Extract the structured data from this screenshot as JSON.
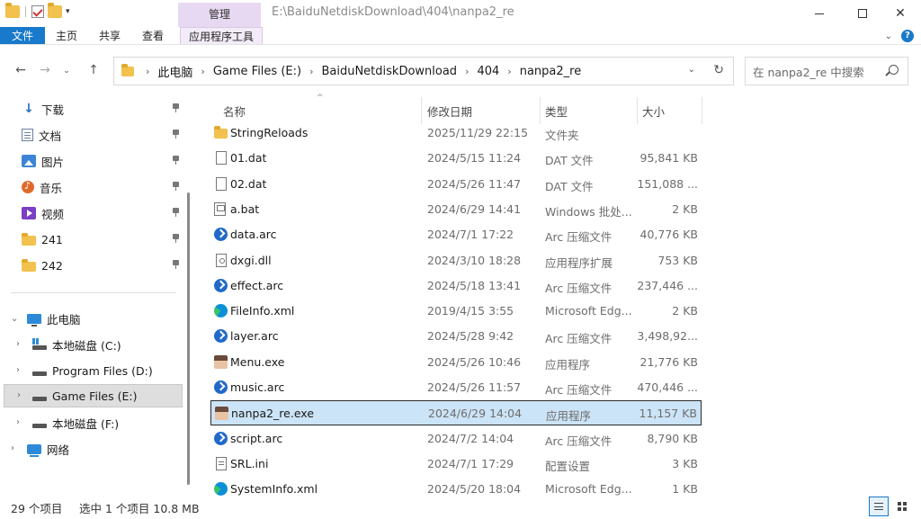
{
  "window": {
    "path_title": "E:\\BaiduNetdiskDownload\\404\\nanpa2_re",
    "context_group": "管理"
  },
  "ribbon": {
    "tabs": [
      "文件",
      "主页",
      "共享",
      "查看"
    ],
    "context_tab": "应用程序工具"
  },
  "address": {
    "crumbs": [
      "此电脑",
      "Game Files (E:)",
      "BaiduNetdiskDownload",
      "404",
      "nanpa2_re"
    ],
    "search_placeholder": "在 nanpa2_re 中搜索"
  },
  "nav": {
    "quick_access": [
      {
        "label": "下载",
        "icon": "download-icon"
      },
      {
        "label": "文档",
        "icon": "documents-icon"
      },
      {
        "label": "图片",
        "icon": "pictures-icon"
      },
      {
        "label": "音乐",
        "icon": "music-icon"
      },
      {
        "label": "视频",
        "icon": "videos-icon"
      },
      {
        "label": "241",
        "icon": "folder-icon"
      },
      {
        "label": "242",
        "icon": "folder-icon"
      }
    ],
    "this_pc": "此电脑",
    "drives": [
      "本地磁盘 (C:)",
      "Program Files (D:)",
      "Game Files (E:)",
      "本地磁盘 (F:)"
    ],
    "network": "网络"
  },
  "columns": {
    "name": "名称",
    "date": "修改日期",
    "type": "类型",
    "size": "大小"
  },
  "files": [
    {
      "name": "StringReloads",
      "date": "2025/11/29 22:15",
      "type": "文件夹",
      "size": "",
      "icon": "folder-icon"
    },
    {
      "name": "01.dat",
      "date": "2024/5/15 11:24",
      "type": "DAT 文件",
      "size": "95,841 KB",
      "icon": "file-icon"
    },
    {
      "name": "02.dat",
      "date": "2024/5/26 11:47",
      "type": "DAT 文件",
      "size": "151,088 ...",
      "icon": "file-icon"
    },
    {
      "name": "a.bat",
      "date": "2024/6/29 14:41",
      "type": "Windows 批处...",
      "size": "2 KB",
      "icon": "batch-file-icon"
    },
    {
      "name": "data.arc",
      "date": "2024/7/1 17:22",
      "type": "Arc 压缩文件",
      "size": "40,776 KB",
      "icon": "arc-archive-icon"
    },
    {
      "name": "dxgi.dll",
      "date": "2024/3/10 18:28",
      "type": "应用程序扩展",
      "size": "753 KB",
      "icon": "dll-file-icon"
    },
    {
      "name": "effect.arc",
      "date": "2024/5/18 13:41",
      "type": "Arc 压缩文件",
      "size": "237,446 ...",
      "icon": "arc-archive-icon"
    },
    {
      "name": "FileInfo.xml",
      "date": "2019/4/15 3:55",
      "type": "Microsoft Edg...",
      "size": "2 KB",
      "icon": "edge-xml-icon"
    },
    {
      "name": "layer.arc",
      "date": "2024/5/28 9:42",
      "type": "Arc 压缩文件",
      "size": "3,498,92...",
      "icon": "arc-archive-icon"
    },
    {
      "name": "Menu.exe",
      "date": "2024/5/26 10:46",
      "type": "应用程序",
      "size": "21,776 KB",
      "icon": "exe-app-icon"
    },
    {
      "name": "music.arc",
      "date": "2024/5/26 11:57",
      "type": "Arc 压缩文件",
      "size": "470,446 ...",
      "icon": "arc-archive-icon"
    },
    {
      "name": "nanpa2_re.exe",
      "date": "2024/6/29 14:04",
      "type": "应用程序",
      "size": "11,157 KB",
      "icon": "exe-app-icon"
    },
    {
      "name": "script.arc",
      "date": "2024/7/2 14:04",
      "type": "Arc 压缩文件",
      "size": "8,790 KB",
      "icon": "arc-archive-icon"
    },
    {
      "name": "SRL.ini",
      "date": "2024/7/1 17:29",
      "type": "配置设置",
      "size": "3 KB",
      "icon": "ini-file-icon"
    },
    {
      "name": "SystemInfo.xml",
      "date": "2024/5/20 18:04",
      "type": "Microsoft Edg...",
      "size": "1 KB",
      "icon": "edge-xml-icon"
    }
  ],
  "status": {
    "count": "29 个项目",
    "selection": "选中 1 个项目  10.8 MB"
  }
}
